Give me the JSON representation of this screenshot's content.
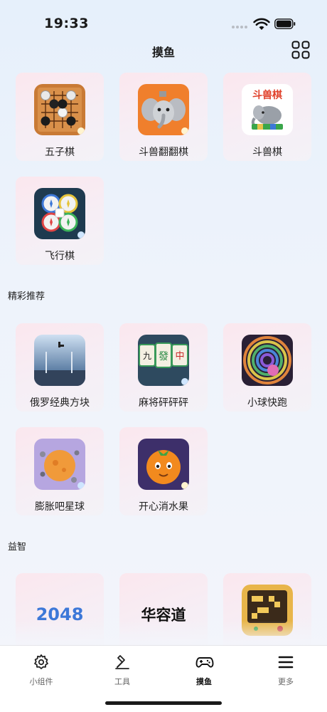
{
  "status": {
    "time": "19:33"
  },
  "header": {
    "title": "摸鱼"
  },
  "top_games": [
    {
      "label": "五子棋"
    },
    {
      "label": "斗兽翻翻棋"
    },
    {
      "label": "斗兽棋",
      "icon_text": "斗兽棋"
    },
    {
      "label": "飞行棋"
    }
  ],
  "sections": [
    {
      "title": "精彩推荐",
      "games": [
        {
          "label": "俄罗经典方块"
        },
        {
          "label": "麻将砰砰砰",
          "tiles": [
            "九",
            "發",
            "中"
          ]
        },
        {
          "label": "小球快跑"
        },
        {
          "label": "膨胀吧星球"
        },
        {
          "label": "开心消水果"
        }
      ]
    },
    {
      "title": "益智",
      "games": [
        {
          "label": "",
          "icon_text": "2048"
        },
        {
          "label": "",
          "icon_text": "华容道"
        },
        {
          "label": ""
        }
      ]
    }
  ],
  "tabs": [
    {
      "label": "小组件",
      "icon": "gear-icon"
    },
    {
      "label": "工具",
      "icon": "hammer-icon"
    },
    {
      "label": "摸鱼",
      "icon": "gamepad-icon",
      "active": true
    },
    {
      "label": "更多",
      "icon": "menu-icon"
    }
  ]
}
